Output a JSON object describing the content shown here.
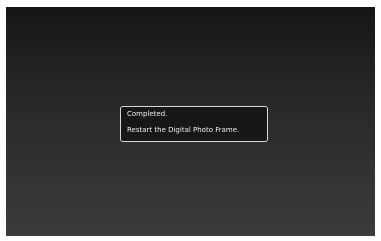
{
  "dialog": {
    "title": "Completed.",
    "message": "Restart the Digital Photo Frame."
  },
  "colors": {
    "page_background": "#ffffff",
    "screen_top": "#161616",
    "screen_bottom": "#3b3b3b",
    "dialog_border": "#d8d8d8",
    "dialog_text": "#f0f0f0"
  }
}
